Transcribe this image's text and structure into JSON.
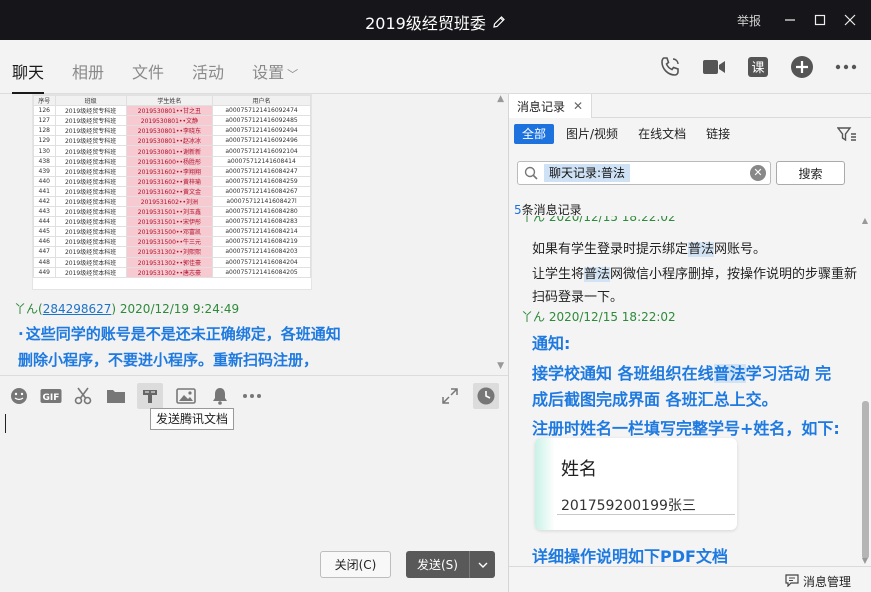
{
  "window": {
    "title": "2019级经贸班委",
    "report_label": "举报"
  },
  "nav": {
    "tabs": [
      "聊天",
      "相册",
      "文件",
      "活动",
      "设置"
    ]
  },
  "spreadsheet": {
    "headers": [
      "序号",
      "班级",
      "学生姓名",
      "用户名"
    ],
    "rows": [
      [
        "126",
        "2019级经贸专科班",
        "2019530801••甘之丑",
        "a000757121416092474"
      ],
      [
        "127",
        "2019级经贸专科班",
        "2019530801••文静",
        "a000757121416092485"
      ],
      [
        "128",
        "2019级经贸专科班",
        "2019530801••李晓东",
        "a000757121416092494"
      ],
      [
        "129",
        "2019级经贸专科班",
        "2019530801••赵冰冰",
        "a000757121416092496"
      ],
      [
        "130",
        "2019级经贸专科班",
        "2019530801••谢新新",
        "a000757121416092104"
      ],
      [
        "438",
        "2019级经贸本科班",
        "2019531600••杨胜彤",
        "a00075712141608414"
      ],
      [
        "439",
        "2019级经贸本科班",
        "2019531602••李翔翔",
        "a000757121416084247"
      ],
      [
        "440",
        "2019级经贸本科班",
        "2019531602••黄梓瑜",
        "a000757121416084259"
      ],
      [
        "441",
        "2019级经贸本科班",
        "2019531602••黄文金",
        "a000757121416084267"
      ],
      [
        "442",
        "2019级经贸本科班",
        "2019531602••刘洲",
        "a00075712141608427l"
      ],
      [
        "443",
        "2019级经贸本科班",
        "2019531501••刘玉鑫",
        "a000757121416084280"
      ],
      [
        "444",
        "2019级经贸本科班",
        "2019531501••宋伊彤",
        "a000757121416084283"
      ],
      [
        "445",
        "2019级经贸本科班",
        "2019531500••邓富凯",
        "a000757121416084214"
      ],
      [
        "446",
        "2019级经贸本科班",
        "2019531500••牛三元",
        "a000757121416084219"
      ],
      [
        "447",
        "2019级经贸本科班",
        "2019531302••刘熙熙",
        "a000757121416084203"
      ],
      [
        "448",
        "2019级经贸本科班",
        "2019531302••郭佳豪",
        "a000757121416084204"
      ],
      [
        "449",
        "2019级经贸本科班",
        "2019531302••唐志豪",
        "a000757121416084205"
      ]
    ]
  },
  "chat": {
    "sender_name": "丫ん(",
    "sender_qq": "284298627",
    "sender_suffix": ") 2020/12/19 9:24:49",
    "message_line1": "这些同学的账号是不是还未正确绑定，各班通知",
    "message_line2": "删除小程序，不要进小程序。重新扫码注册，"
  },
  "toolbar": {
    "tooltip": "发送腾讯文档"
  },
  "buttons": {
    "close": "关闭(C)",
    "send": "发送(S)"
  },
  "history": {
    "tab_label": "消息记录",
    "filters": [
      "全部",
      "图片/视频",
      "在线文档",
      "链接"
    ],
    "search_value": "聊天记录:普法",
    "search_button": "搜索",
    "count_number": "5",
    "count_text": "条消息记录",
    "cut_header": "丫ん 2020/12/15 18:22:02",
    "line1_a": "如果有学生登录时提示绑定",
    "line1_hl": "普法",
    "line1_b": "网账号。",
    "line2_a": "让学生将",
    "line2_hl": "普法",
    "line2_b": "网微信小程序删掉，按操作说明的步骤重新",
    "line3": "扫码登录一下。",
    "sender2": "丫ん 2020/12/15 18:22:02",
    "b1": "通知:",
    "b2_a": "接学校通知  各班组织在线",
    "b2_hl": "普法",
    "b2_b": "学习活动   完",
    "b3": "成后截图完成界面 各班汇总上交。",
    "b4": "注册时姓名一栏填写完整学号+姓名，如下:",
    "card_label": "姓名",
    "card_value": "201759200199张三",
    "b5": "详细操作说明如下PDF文档",
    "footer": "消息管理"
  }
}
